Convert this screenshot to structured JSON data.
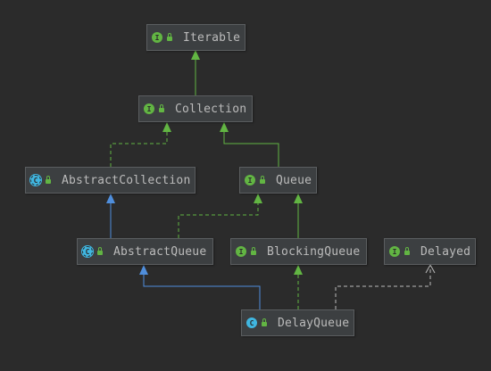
{
  "colors": {
    "background": "#2b2b2b",
    "node_fill": "#3c3f41",
    "node_border": "#5b5e60",
    "text": "#bbbbbb",
    "interface_icon": "#62b543",
    "class_icon": "#40b6e0",
    "extends_class_edge": "#4f8edc",
    "implements_edge": "#62b543",
    "interface_extends_edge": "#62b543",
    "dependency_edge": "#bbbbbb"
  },
  "nodes": {
    "iterable": {
      "name": "Iterable",
      "kind": "interface",
      "kind_glyph": "I",
      "icon": "interface-icon"
    },
    "collection": {
      "name": "Collection",
      "kind": "interface",
      "kind_glyph": "I",
      "icon": "interface-icon"
    },
    "abstract_collection": {
      "name": "AbstractCollection",
      "kind": "abstract",
      "kind_glyph": "C",
      "icon": "abstract-class-icon"
    },
    "queue": {
      "name": "Queue",
      "kind": "interface",
      "kind_glyph": "I",
      "icon": "interface-icon"
    },
    "abstract_queue": {
      "name": "AbstractQueue",
      "kind": "abstract",
      "kind_glyph": "C",
      "icon": "abstract-class-icon"
    },
    "blocking_queue": {
      "name": "BlockingQueue",
      "kind": "interface",
      "kind_glyph": "I",
      "icon": "interface-icon"
    },
    "delayed": {
      "name": "Delayed",
      "kind": "interface",
      "kind_glyph": "I",
      "icon": "interface-icon"
    },
    "delay_queue": {
      "name": "DelayQueue",
      "kind": "class",
      "kind_glyph": "C",
      "icon": "class-icon"
    }
  },
  "edges": [
    {
      "from": "collection",
      "to": "iterable",
      "type": "interface-extends"
    },
    {
      "from": "abstract_collection",
      "to": "collection",
      "type": "implements"
    },
    {
      "from": "queue",
      "to": "collection",
      "type": "interface-extends"
    },
    {
      "from": "abstract_queue",
      "to": "abstract_collection",
      "type": "extends"
    },
    {
      "from": "abstract_queue",
      "to": "queue",
      "type": "implements"
    },
    {
      "from": "blocking_queue",
      "to": "queue",
      "type": "interface-extends"
    },
    {
      "from": "delay_queue",
      "to": "abstract_queue",
      "type": "extends"
    },
    {
      "from": "delay_queue",
      "to": "blocking_queue",
      "type": "implements"
    },
    {
      "from": "delay_queue",
      "to": "delayed",
      "type": "dependency"
    }
  ]
}
